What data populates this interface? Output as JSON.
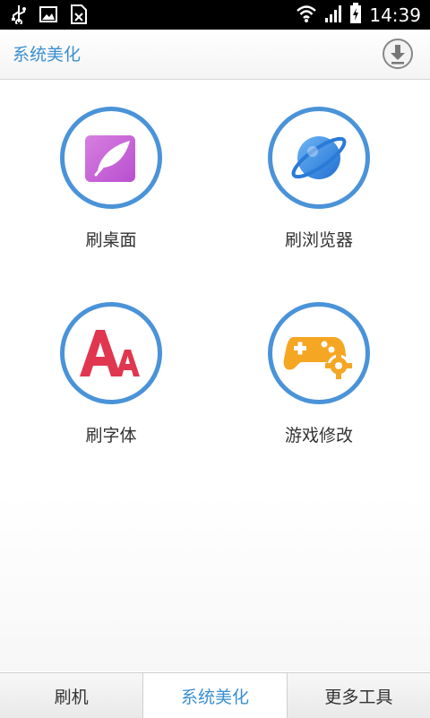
{
  "status_bar": {
    "time": "14:39"
  },
  "header": {
    "title": "系统美化"
  },
  "tiles": [
    {
      "label": "刷桌面"
    },
    {
      "label": "刷浏览器"
    },
    {
      "label": "刷字体"
    },
    {
      "label": "游戏修改"
    }
  ],
  "tabs": [
    {
      "label": "刷机"
    },
    {
      "label": "系统美化"
    },
    {
      "label": "更多工具"
    }
  ],
  "colors": {
    "accent": "#3a8fd0",
    "ring": "#4a93d9",
    "status_bg": "#000000"
  }
}
